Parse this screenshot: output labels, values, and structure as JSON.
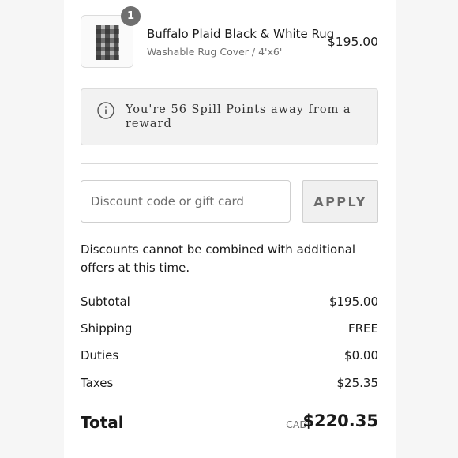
{
  "line_item": {
    "quantity": "1",
    "title": "Buffalo Plaid Black & White Rug",
    "variant": "Washable Rug Cover / 4'x6'",
    "price": "$195.00"
  },
  "points_banner": {
    "icon": "info-icon",
    "text": "You're 56 Spill Points away from a reward"
  },
  "discount": {
    "placeholder": "Discount code or gift card",
    "value": "",
    "apply_label": "APPLY"
  },
  "notice": "Discounts cannot be combined with additional offers at this time.",
  "summary": {
    "subtotal_label": "Subtotal",
    "subtotal_value": "$195.00",
    "shipping_label": "Shipping",
    "shipping_value": "FREE",
    "duties_label": "Duties",
    "duties_value": "$0.00",
    "taxes_label": "Taxes",
    "taxes_value": "$25.35"
  },
  "total": {
    "label": "Total",
    "currency": "CAD",
    "value": "$220.35"
  },
  "colors": {
    "page_background": "#f6f6f6",
    "panel_background": "#ffffff",
    "badge": "#6f6f6f",
    "banner_background": "#f2f2f2",
    "apply_button": "#f0f0f0"
  }
}
